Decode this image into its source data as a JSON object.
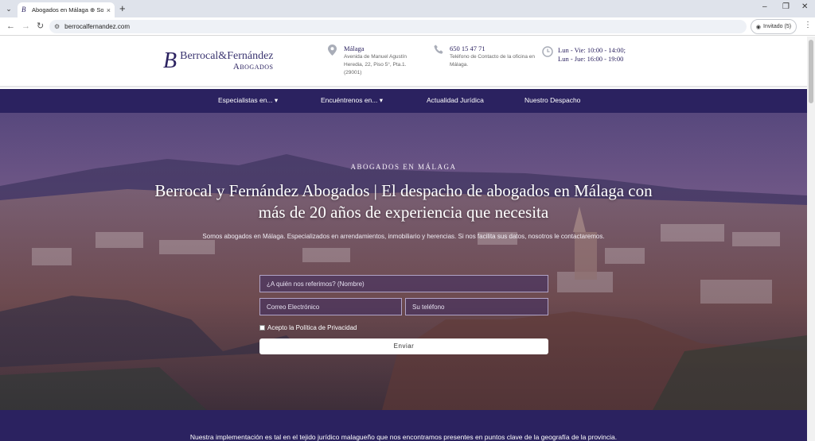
{
  "browser": {
    "tab_title": "Abogados en Málaga ⊕ Somos",
    "url": "berrocalfernandez.com",
    "profile_label": "Invitado (5)"
  },
  "header": {
    "logo_line1": "Berrocal&Fernández",
    "logo_line2": "Abogados",
    "address_title": "Málaga",
    "address_text": "Avenida de Manuel Agustín Heredia, 22, Piso 5°, Pta.1. (29001)",
    "phone_title": "650 15 47 71",
    "phone_text": "Teléfono de Contacto de la oficina en Málaga.",
    "hours_line1": "Lun - Vie: 10:00 - 14:00;",
    "hours_line2": "Lun - Jue: 16:00 - 19:00"
  },
  "nav": {
    "items": [
      {
        "label": "Especialistas en... ▾"
      },
      {
        "label": "Encuéntrenos en... ▾"
      },
      {
        "label": "Actualidad Jurídica"
      },
      {
        "label": "Nuestro Despacho"
      }
    ]
  },
  "hero": {
    "kicker": "ABOGADOS EN MÁLAGA",
    "title": "Berrocal y Fernández Abogados | El despacho de abogados en Málaga con más de 20 años de experiencia que necesita",
    "subtitle": "Somos abogados en Málaga. Especializados en arrendamientos, inmobiliario y herencias. Si nos facilita sus datos, nosotros le contactaremos.",
    "name_placeholder": "¿A quién nos referimos? (Nombre)",
    "email_placeholder": "Correo Electrónico",
    "phone_placeholder": "Su teléfono",
    "privacy_label": "Acepto la Política de Privacidad",
    "submit_label": "Enviar"
  },
  "band": {
    "text": "Nuestra implementación es tal en el tejido jurídico malagueño que nos encontramos presentes en puntos clave de la geografía de la provincia."
  },
  "colors": {
    "brand": "#2b2260",
    "nav_bg": "#2b2260"
  }
}
